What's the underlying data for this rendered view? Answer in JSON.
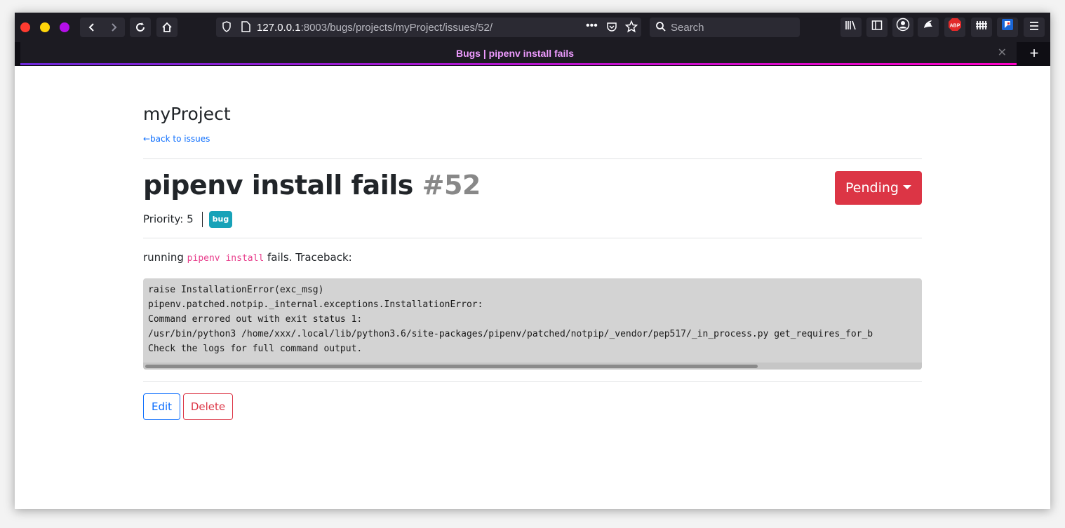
{
  "browser": {
    "url_host": "127.0.0.1",
    "url_rest": ":8003/bugs/projects/myProject/issues/52/",
    "search_placeholder": "Search",
    "tab_title": "Bugs | pipenv install fails",
    "extensions": [
      "library-icon",
      "sidebar-icon",
      "account-icon",
      "extension-bird-icon",
      "adblock-plus-icon",
      "extension-fence-icon",
      "extension-flag-icon",
      "menu-icon"
    ],
    "abp_label": "ABP"
  },
  "page": {
    "project_name": "myProject",
    "back_link": "←back to issues",
    "issue_title": "pipenv install fails",
    "issue_number": "#52",
    "status_button": "Pending",
    "priority_label": "Priority: 5",
    "tag": "bug",
    "description_prefix": "running",
    "description_code": "pipenv install",
    "description_suffix": "fails. Traceback:",
    "code_lines": [
      "raise InstallationError(exc_msg)",
      "pipenv.patched.notpip._internal.exceptions.InstallationError:",
      "Command errored out with exit status 1:",
      "/usr/bin/python3 /home/xxx/.local/lib/python3.6/site-packages/pipenv/patched/notpip/_vendor/pep517/_in_process.py get_requires_for_b",
      "Check the logs for full command output."
    ],
    "edit_button": "Edit",
    "delete_button": "Delete"
  },
  "colors": {
    "danger": "#dc3545",
    "primary": "#0d6efd",
    "info": "#17a2b8",
    "tab_title": "#ee9bff"
  }
}
